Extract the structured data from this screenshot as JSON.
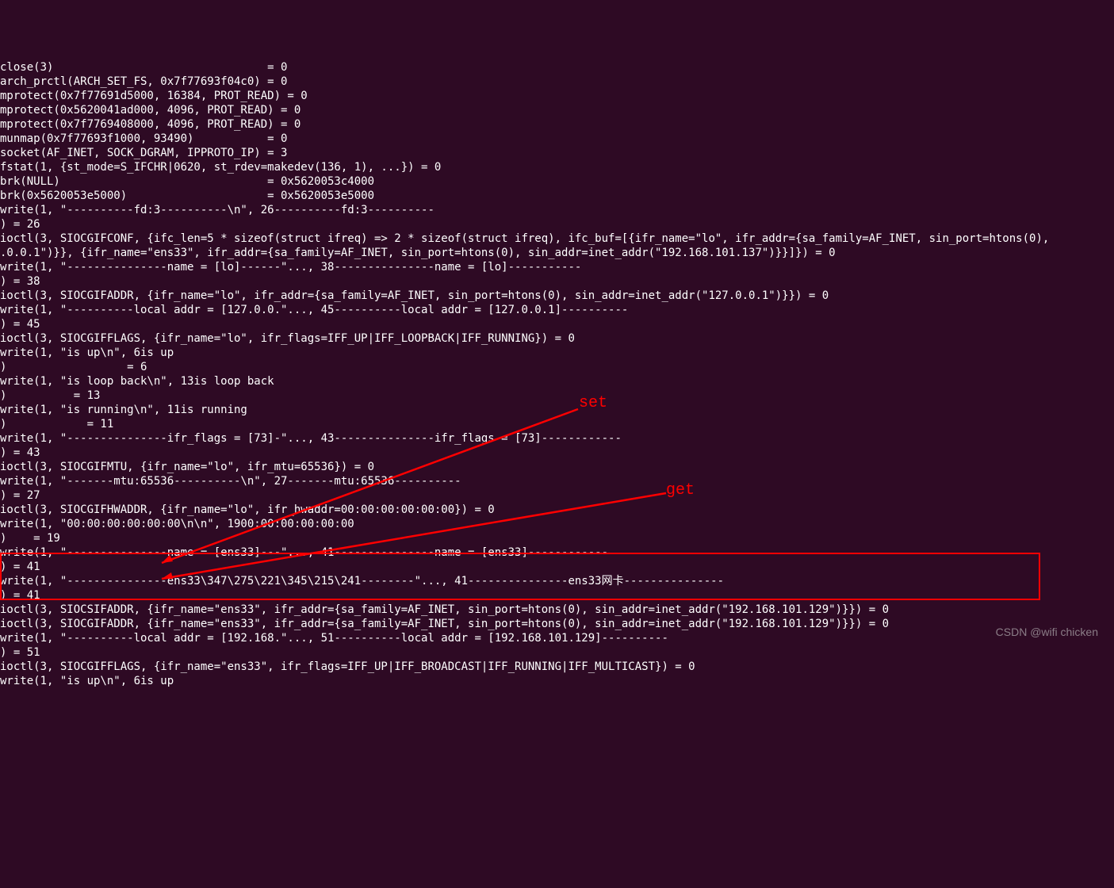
{
  "lines": [
    "close(3)                                = 0",
    "arch_prctl(ARCH_SET_FS, 0x7f77693f04c0) = 0",
    "mprotect(0x7f77691d5000, 16384, PROT_READ) = 0",
    "mprotect(0x5620041ad000, 4096, PROT_READ) = 0",
    "mprotect(0x7f7769408000, 4096, PROT_READ) = 0",
    "munmap(0x7f77693f1000, 93490)           = 0",
    "socket(AF_INET, SOCK_DGRAM, IPPROTO_IP) = 3",
    "fstat(1, {st_mode=S_IFCHR|0620, st_rdev=makedev(136, 1), ...}) = 0",
    "brk(NULL)                               = 0x5620053c4000",
    "brk(0x5620053e5000)                     = 0x5620053e5000",
    "write(1, \"----------fd:3----------\\n\", 26----------fd:3----------",
    ") = 26",
    "ioctl(3, SIOCGIFCONF, {ifc_len=5 * sizeof(struct ifreq) => 2 * sizeof(struct ifreq), ifc_buf=[{ifr_name=\"lo\", ifr_addr={sa_family=AF_INET, sin_port=htons(0),",
    ".0.0.1\")}}, {ifr_name=\"ens33\", ifr_addr={sa_family=AF_INET, sin_port=htons(0), sin_addr=inet_addr(\"192.168.101.137\")}}]}) = 0",
    "write(1, \"---------------name = [lo]------\"..., 38---------------name = [lo]-----------",
    ") = 38",
    "ioctl(3, SIOCGIFADDR, {ifr_name=\"lo\", ifr_addr={sa_family=AF_INET, sin_port=htons(0), sin_addr=inet_addr(\"127.0.0.1\")}}) = 0",
    "write(1, \"----------local addr = [127.0.0.\"..., 45----------local addr = [127.0.0.1]----------",
    ") = 45",
    "ioctl(3, SIOCGIFFLAGS, {ifr_name=\"lo\", ifr_flags=IFF_UP|IFF_LOOPBACK|IFF_RUNNING}) = 0",
    "write(1, \"is up\\n\", 6is up",
    ")                  = 6",
    "write(1, \"is loop back\\n\", 13is loop back",
    ")          = 13",
    "write(1, \"is running\\n\", 11is running",
    ")            = 11",
    "write(1, \"---------------ifr_flags = [73]-\"..., 43---------------ifr_flags = [73]------------",
    ") = 43",
    "ioctl(3, SIOCGIFMTU, {ifr_name=\"lo\", ifr_mtu=65536}) = 0",
    "write(1, \"-------mtu:65536----------\\n\", 27-------mtu:65536----------",
    ") = 27",
    "ioctl(3, SIOCGIFHWADDR, {ifr_name=\"lo\", ifr_hwaddr=00:00:00:00:00:00}) = 0",
    "write(1, \"00:00:00:00:00:00\\n\\n\", 1900:00:00:00:00:00",
    "",
    ")    = 19",
    "write(1, \"---------------name = [ens33]---\"..., 41---------------name = [ens33]------------",
    ") = 41",
    "write(1, \"---------------ens33\\347\\275\\221\\345\\215\\241--------\"..., 41---------------ens33网卡---------------",
    ") = 41",
    "ioctl(3, SIOCSIFADDR, {ifr_name=\"ens33\", ifr_addr={sa_family=AF_INET, sin_port=htons(0), sin_addr=inet_addr(\"192.168.101.129\")}}) = 0",
    "ioctl(3, SIOCGIFADDR, {ifr_name=\"ens33\", ifr_addr={sa_family=AF_INET, sin_port=htons(0), sin_addr=inet_addr(\"192.168.101.129\")}}) = 0",
    "write(1, \"----------local addr = [192.168.\"..., 51----------local addr = [192.168.101.129]----------",
    ") = 51",
    "ioctl(3, SIOCGIFFLAGS, {ifr_name=\"ens33\", ifr_flags=IFF_UP|IFF_BROADCAST|IFF_RUNNING|IFF_MULTICAST}) = 0",
    "write(1, \"is up\\n\", 6is up"
  ],
  "annotations": {
    "set": "set",
    "get": "get"
  },
  "watermark": "CSDN @wifi chicken"
}
